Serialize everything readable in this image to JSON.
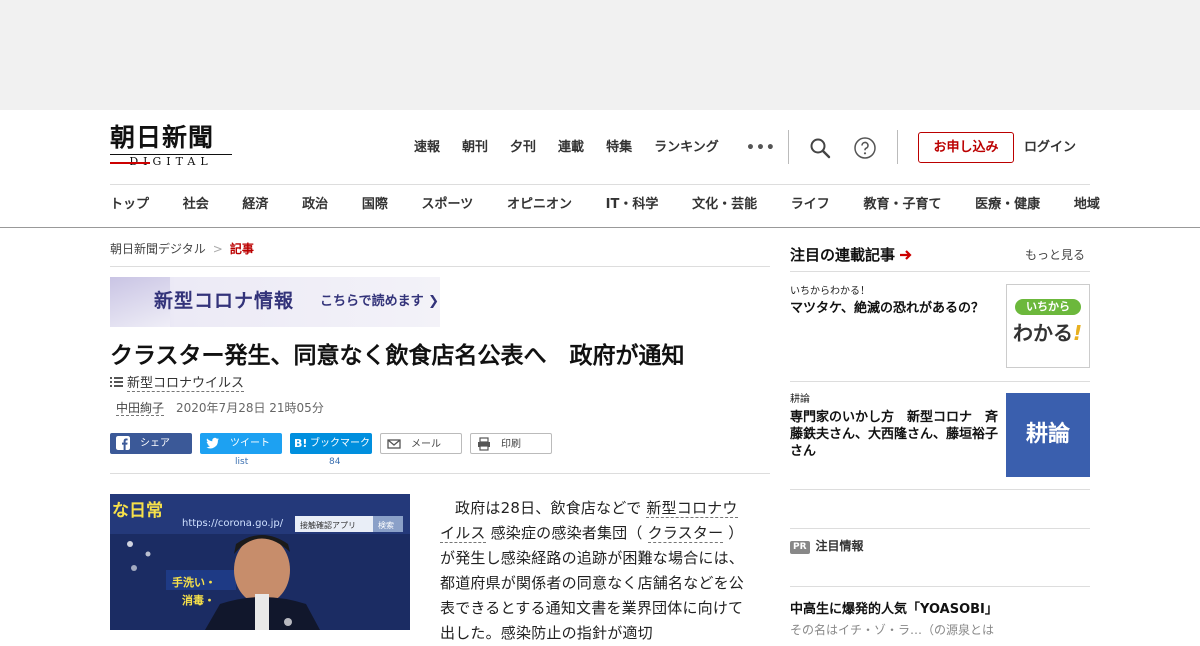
{
  "site": {
    "logo_main": "朝日新聞",
    "logo_sub": "DIGITAL"
  },
  "topnav": [
    "速報",
    "朝刊",
    "夕刊",
    "連載",
    "特集",
    "ランキング"
  ],
  "topnav_more": "•••",
  "header": {
    "subscribe_label": "お申し込み",
    "login_label": "ログイン"
  },
  "catnav": [
    "トップ",
    "社会",
    "経済",
    "政治",
    "国際",
    "スポーツ",
    "オピニオン",
    "IT・科学",
    "文化・芸能",
    "ライフ",
    "教育・子育て",
    "医療・健康",
    "地域"
  ],
  "breadcrumb": {
    "home": "朝日新聞デジタル",
    "sep": ">",
    "current": "記事"
  },
  "corona_banner": {
    "title": "新型コロナ情報",
    "cta": "こちらで読めます ❯"
  },
  "article": {
    "title": "クラスター発生、同意なく飲食店名公表へ　政府が通知",
    "tag": "新型コロナウイルス",
    "author": "中田絢子",
    "date": "2020年7月28日 21時05分",
    "body_p1_pre": "政府は28日、飲食店などで",
    "body_link1": "新型コロナウイルス",
    "body_p1_mid": "感染症の感染者集団（",
    "body_link2": "クラスター",
    "body_p1_post": "）が発生し感染経路の追跡が困難な場合には、都道府県が関係者の同意なく店舗名などを公表できるとする通知文書を業界団体に向けて出した。感染防止の指針が適切",
    "photo_overlay_1": "な日常",
    "photo_overlay_2": "https://corona.go.jp/",
    "photo_overlay_3": "接触確認アプリ",
    "photo_overlay_4": "検索",
    "photo_overlay_5": "手洗い・",
    "photo_overlay_6": "消毒・"
  },
  "share": {
    "facebook": "シェア",
    "twitter": "ツイート",
    "twitter_count": "list",
    "hatena": "ブックマーク",
    "hatena_count": "84",
    "mail": "メール",
    "print": "印刷"
  },
  "sidebar": {
    "heading": "注目の連載記事",
    "more": "もっと見る",
    "items": [
      {
        "kicker": "いちからわかる！",
        "title": "マツタケ、絶滅の恐れがあるの？",
        "thumb_line1": "いちから",
        "thumb_line2": "わかる"
      },
      {
        "kicker": "耕論",
        "title": "専門家のいかし方　新型コロナ　斉藤鉄夫さん、大西隆さん、藤垣裕子さん",
        "thumb_text": "耕論"
      }
    ],
    "pr_badge": "PR",
    "pr_label": "注目情報",
    "news_title": "中高生に爆発的人気「YOASOBI」",
    "news_sub": "その名はイチ・ゾ・ラ…（の源泉とは"
  },
  "colors": {
    "accent_red": "#bb0000",
    "facebook": "#3b5998",
    "twitter": "#1da1f2",
    "hatena": "#008fde"
  }
}
